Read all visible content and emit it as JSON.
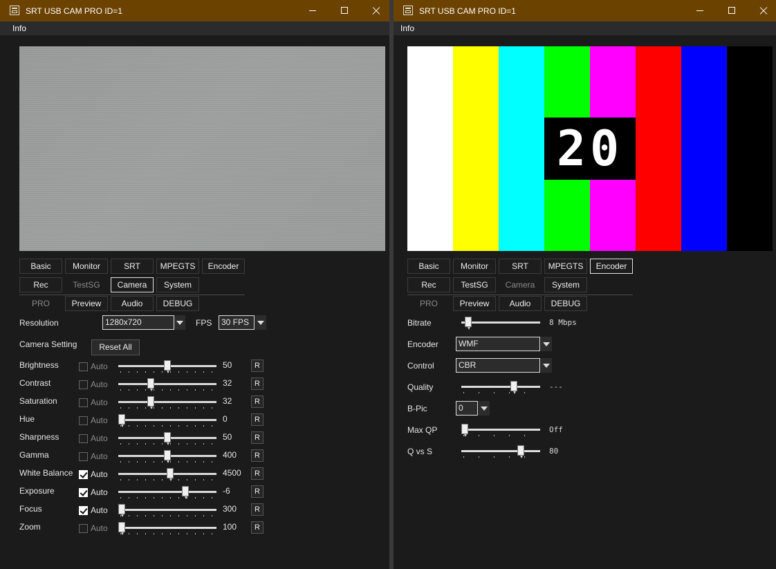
{
  "left_window": {
    "title": "SRT USB CAM PRO ID=1",
    "menu": "Info",
    "tabs_row1": [
      "Basic",
      "Monitor",
      "SRT",
      "MPEGTS",
      "Encoder"
    ],
    "tabs_row2": [
      "Rec",
      "TestSG",
      "Camera",
      "System"
    ],
    "tabs_row3": [
      "PRO",
      "Preview",
      "Audio",
      "DEBUG"
    ],
    "active_tab": "Camera",
    "resolution_label": "Resolution",
    "resolution_value": "1280x720",
    "fps_label": "FPS",
    "fps_value": "30 FPS",
    "camera_setting_label": "Camera Setting",
    "reset_all_label": "Reset All",
    "auto_label": "Auto",
    "reset_label": "R",
    "controls": [
      {
        "label": "Brightness",
        "auto": false,
        "value": "50",
        "position": 0.5
      },
      {
        "label": "Contrast",
        "auto": false,
        "value": "32",
        "position": 0.32
      },
      {
        "label": "Saturation",
        "auto": false,
        "value": "32",
        "position": 0.32
      },
      {
        "label": "Hue",
        "auto": false,
        "value": "0",
        "position": 0.0
      },
      {
        "label": "Sharpness",
        "auto": false,
        "value": "50",
        "position": 0.5
      },
      {
        "label": "Gamma",
        "auto": false,
        "value": "400",
        "position": 0.5
      },
      {
        "label": "White Balance",
        "auto": true,
        "value": "4500",
        "position": 0.53
      },
      {
        "label": "Exposure",
        "auto": true,
        "value": "-6",
        "position": 0.7
      },
      {
        "label": "Focus",
        "auto": true,
        "value": "300",
        "position": 0.0
      },
      {
        "label": "Zoom",
        "auto": false,
        "value": "100",
        "position": 0.0
      }
    ]
  },
  "right_window": {
    "title": "SRT USB CAM PRO ID=1",
    "menu": "Info",
    "tabs_row1": [
      "Basic",
      "Monitor",
      "SRT",
      "MPEGTS",
      "Encoder"
    ],
    "tabs_row2": [
      "Rec",
      "TestSG",
      "Camera",
      "System"
    ],
    "tabs_row3": [
      "PRO",
      "Preview",
      "Audio",
      "DEBUG"
    ],
    "active_tab": "Encoder",
    "test_pattern_counter": "20",
    "color_bars": [
      "#ffffff",
      "#ffff00",
      "#00ffff",
      "#00ff00",
      "#ff00ff",
      "#ff0000",
      "#0000ff",
      "#000000"
    ],
    "bitrate_label": "Bitrate",
    "bitrate_value": "8 Mbps",
    "bitrate_position": 0.05,
    "encoder_label": "Encoder",
    "encoder_value": "WMF",
    "control_label": "Control",
    "control_value": "CBR",
    "quality_label": "Quality",
    "quality_value": "---",
    "quality_position": 0.68,
    "bpic_label": "B-Pic",
    "bpic_value": "0",
    "maxqp_label": "Max QP",
    "maxqp_value": "Off",
    "maxqp_position": 0.0,
    "qvss_label": "Q vs S",
    "qvss_value": "80",
    "qvss_position": 0.78
  }
}
